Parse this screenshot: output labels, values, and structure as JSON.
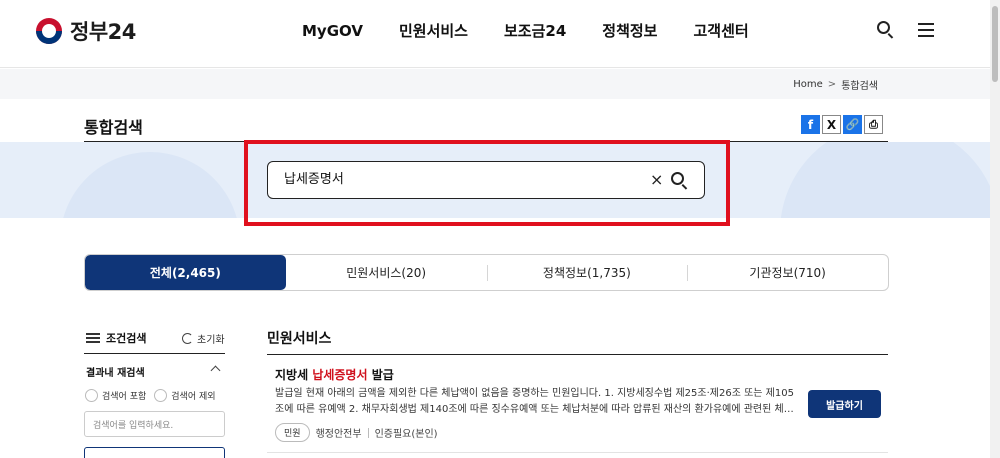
{
  "header": {
    "logo_text": "정부24",
    "nav": [
      "MyGOV",
      "민원서비스",
      "보조금24",
      "정책정보",
      "고객센터"
    ]
  },
  "breadcrumb": {
    "home": "Home",
    "sep": ">",
    "current": "통합검색"
  },
  "page_title": "통합검색",
  "share": {
    "facebook": "f",
    "x": "X",
    "link": "🔗",
    "print": "⎙"
  },
  "search": {
    "value": "납세증명서",
    "clear": "×"
  },
  "tabs": [
    {
      "label": "전체(2,465)",
      "active": true
    },
    {
      "label": "민원서비스(20)",
      "active": false
    },
    {
      "label": "정책정보(1,735)",
      "active": false
    },
    {
      "label": "기관정보(710)",
      "active": false
    }
  ],
  "filter": {
    "title": "조건검색",
    "reset": "초기화",
    "refine_title": "결과내 재검색",
    "include": "검색어 포함",
    "exclude": "검색어 제외",
    "placeholder": "검색어를 입력하세요."
  },
  "results": {
    "section_title": "민원서비스",
    "item": {
      "title_prefix": "지방세 ",
      "title_highlight": "납세증명서",
      "title_suffix": " 발급",
      "desc_line1": "발급일 현재 아래의 금액을 제외한 다른 체납액이 없음을 증명하는 민원입니다. 1. 지방세징수법 제25조·제26조 또는 제105",
      "desc_line2": "조에 따른 유예액 2. 채무자회생법 제140조에 따른 징수유예액 또는 체납처분에 따라 압류된 재산의 환가유예에 관련된 체…",
      "chip": "민원",
      "agency": "행정안전부",
      "auth": "인증필요(본인)",
      "button": "발급하기"
    }
  },
  "colors": {
    "accent": "#0f3578",
    "highlight": "#e0101e",
    "band": "#e6eef9"
  }
}
